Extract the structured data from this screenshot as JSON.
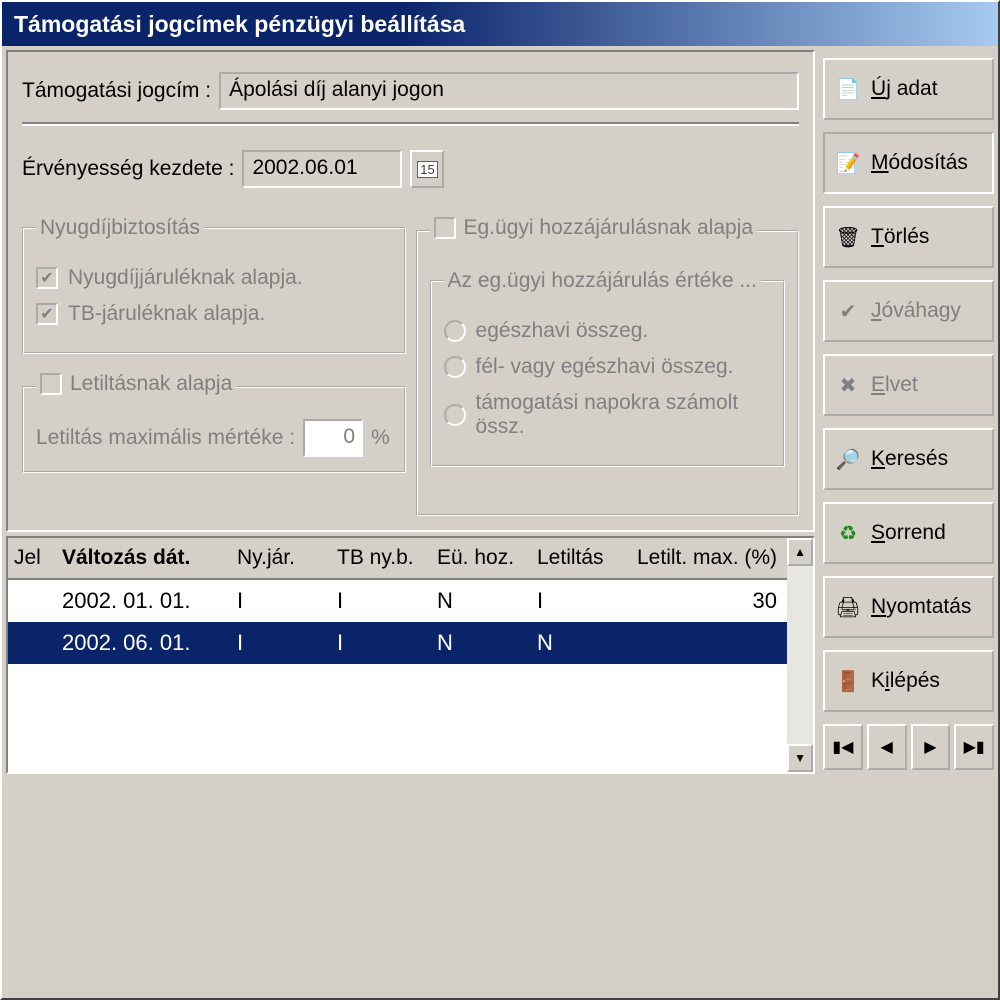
{
  "title": "Támogatási jogcímek pénzügyi beállítása",
  "form": {
    "jogcim_label": "Támogatási jogcím :",
    "jogcim_value": "Ápolási díj alanyi jogon",
    "ervenyesseg_label": "Érvényesség kezdete :",
    "ervenyesseg_value": "2002.06.01",
    "date_icon": "15",
    "nyugdij_group": "Nyugdíjbiztosítás",
    "nyj_alapja": "Nyugdíjjáruléknak alapja.",
    "tb_alapja": "TB-járuléknak alapja.",
    "letiltas_group": "Letiltásnak alapja",
    "letiltas_max_label": "Letiltás maximális mértéke :",
    "letiltas_max_value": "0",
    "percent": "%",
    "eg_hozz_label": "Eg.ügyi hozzájárulásnak alapja",
    "eg_ertek_group": "Az eg.ügyi hozzájárulás értéke ...",
    "eg_opt1": "egészhavi összeg.",
    "eg_opt2": "fél- vagy egészhavi összeg.",
    "eg_opt3": "támogatási napokra számolt össz."
  },
  "buttons": {
    "uj": "Új adat",
    "modositas": "Módosítás",
    "torles": "Törlés",
    "jovahagy": "Jóváhagy",
    "elvet": "Elvet",
    "kereses": "Keresés",
    "sorrend": "Sorrend",
    "nyomtatas": "Nyomtatás",
    "kilepes": "Kilépés"
  },
  "table": {
    "headers": {
      "jel": "Jel",
      "date": "Változás dát.",
      "nyj": "Ny.jár.",
      "tb": "TB ny.b.",
      "eu": "Eü. hoz.",
      "let": "Letiltás",
      "max": "Letilt. max. (%)"
    },
    "rows": [
      {
        "jel": "",
        "date": "2002. 01. 01.",
        "nyj": "I",
        "tb": "I",
        "eu": "N",
        "let": "I",
        "max": "30",
        "selected": false
      },
      {
        "jel": "",
        "date": "2002. 06. 01.",
        "nyj": "I",
        "tb": "I",
        "eu": "N",
        "let": "N",
        "max": "",
        "selected": true
      }
    ]
  }
}
